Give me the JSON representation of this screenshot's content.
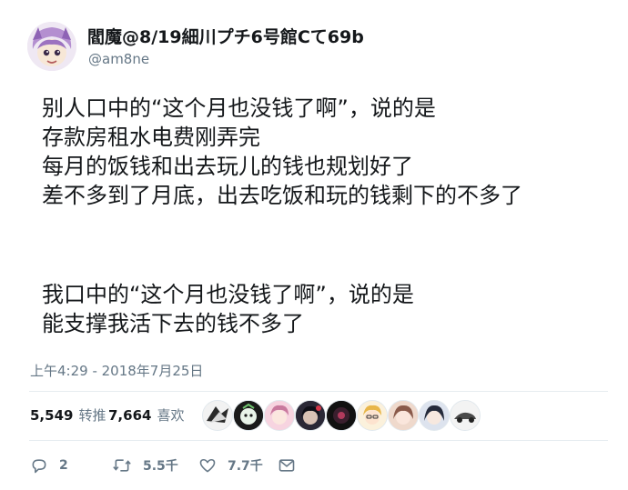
{
  "author": {
    "display_name": "閻魔@8/19細川プチ6号館Cて69b",
    "handle": "@am8ne",
    "avatar_icon": "anime-character-avatar"
  },
  "tweet": {
    "paragraph1": [
      "别人口中的“这个月也没钱了啊”，说的是",
      "存款房租水电费刚弄完",
      "每月的饭钱和出去玩儿的钱也规划好了",
      "差不多到了月底，出去吃饭和玩的钱剩下的不多了"
    ],
    "paragraph2": [
      "我口中的“这个月也没钱了啊”，说的是",
      "能支撑我活下去的钱不多了"
    ]
  },
  "timestamp": "上午4:29 - 2018年7月25日",
  "stats": {
    "retweets_count": "5,549",
    "retweets_label": "转推",
    "likes_count": "7,664",
    "likes_label": "喜欢"
  },
  "liker_avatars": [
    "liker-avatar-1",
    "liker-avatar-2",
    "liker-avatar-3",
    "liker-avatar-4",
    "liker-avatar-5",
    "liker-avatar-6",
    "liker-avatar-7",
    "liker-avatar-8",
    "liker-avatar-9"
  ],
  "actions": {
    "reply_count": "2",
    "retweet_count": "5.5千",
    "like_count": "7.7千"
  },
  "colors": {
    "text": "#14171a",
    "secondary": "#657786",
    "divider": "#e6ecf0"
  }
}
